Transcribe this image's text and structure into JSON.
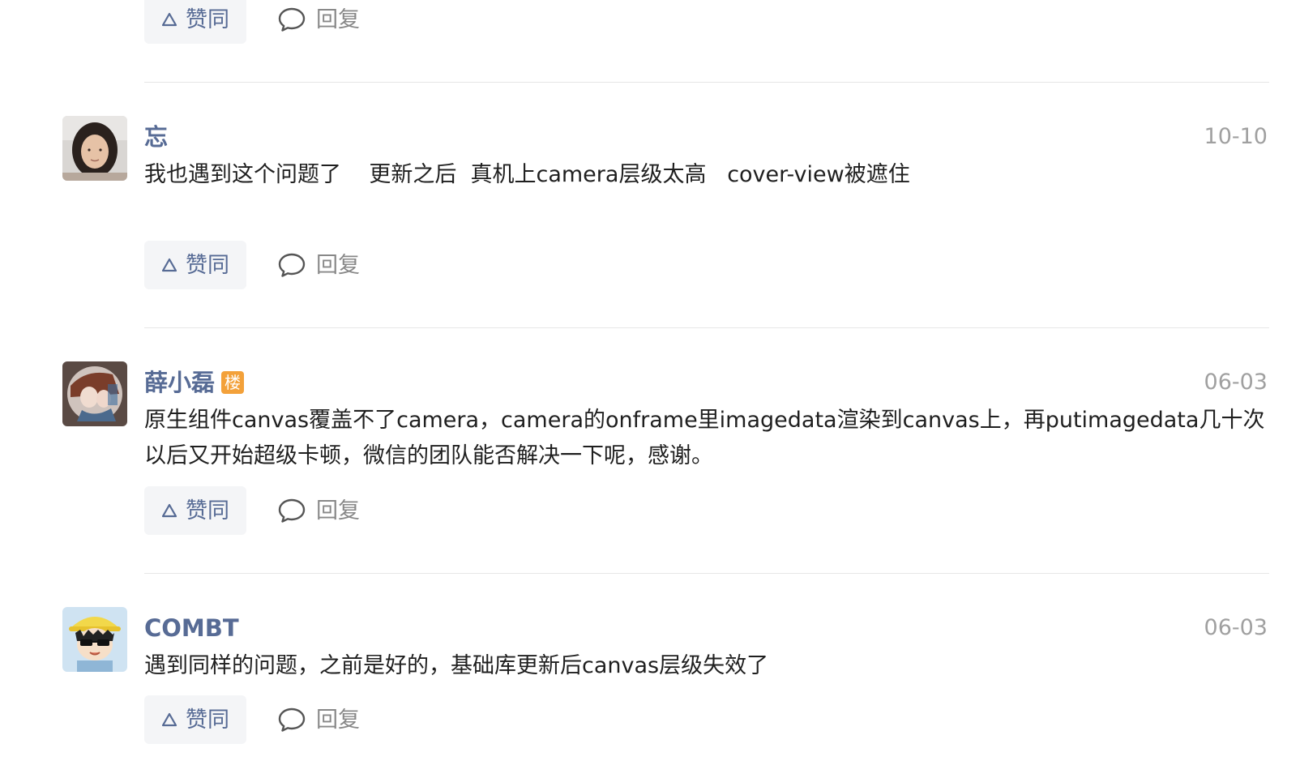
{
  "actions": {
    "like_label": "赞同",
    "reply_label": "回复"
  },
  "comments": [
    {
      "author": "忘",
      "date": "10-10",
      "text": "我也遇到这个问题了    更新之后  真机上camera层级太高   cover-view被遮住",
      "avatar_icon": "woman-photo-avatar"
    },
    {
      "author": "薛小磊",
      "owner_badge": "楼",
      "date": "06-03",
      "text": "原生组件canvas覆盖不了camera，camera的onframe里imagedata渲染到canvas上，再putimagedata几十次以后又开始超级卡顿，微信的团队能否解决一下呢，感谢。",
      "avatar_icon": "anime-couple-avatar"
    },
    {
      "author": "COMBT",
      "date": "06-03",
      "text": "遇到同样的问题，之前是好的，基础库更新后canvas层级失效了",
      "avatar_icon": "cartoon-sunglasses-avatar"
    }
  ],
  "icons": {
    "like": "triangle-up-icon",
    "reply": "speech-bubble-icon"
  },
  "colors": {
    "link_blue": "#576b95",
    "muted_gray": "#a0a0a0",
    "button_bg": "#f4f5f7",
    "badge_orange": "#f3a13a",
    "divider": "#e6e6e6"
  }
}
